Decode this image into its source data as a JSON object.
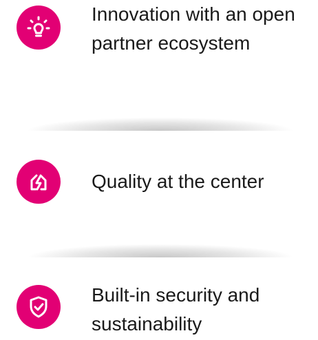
{
  "accent_color": "#e20074",
  "features": [
    {
      "icon": "lightbulb-icon",
      "label": "Innovation with an open partner ecosystem"
    },
    {
      "icon": "quality-house-icon",
      "label": "Quality at the center"
    },
    {
      "icon": "shield-check-icon",
      "label": "Built-in security and sustainability"
    }
  ]
}
